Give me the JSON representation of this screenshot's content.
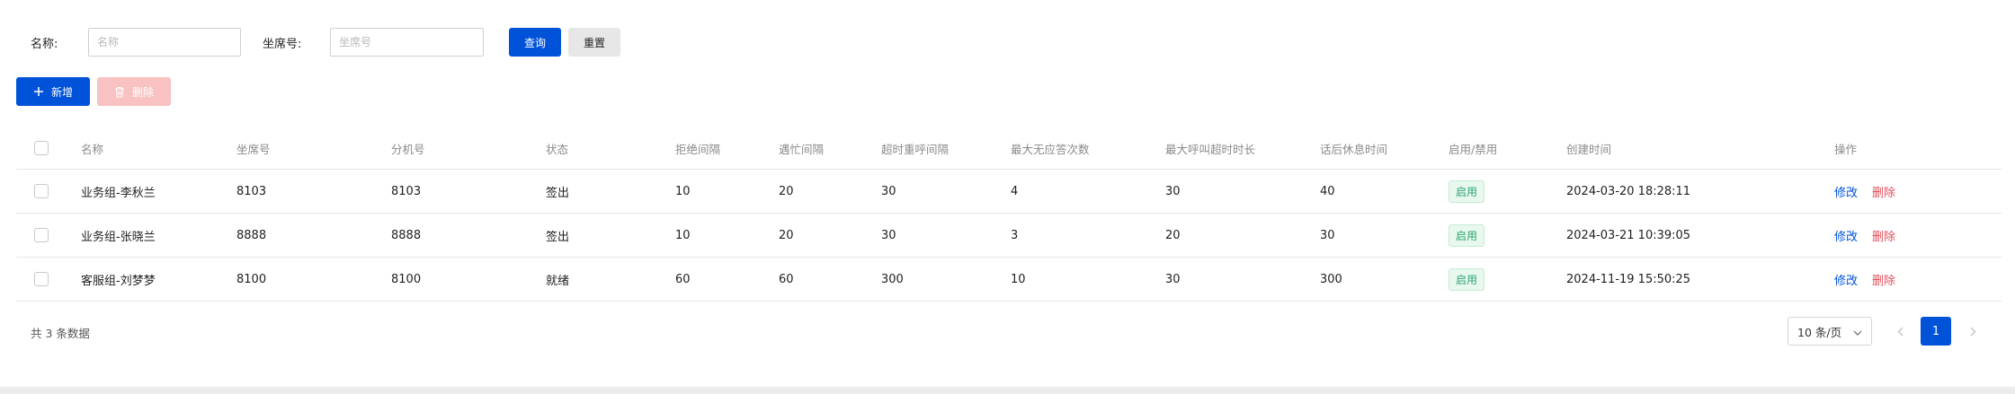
{
  "search": {
    "name_label": "名称:",
    "name_placeholder": "名称",
    "seat_label": "坐席号:",
    "seat_placeholder": "坐席号",
    "query_button": "查询",
    "reset_button": "重置"
  },
  "toolbar": {
    "add_button": "新增",
    "delete_button": "删除"
  },
  "table": {
    "columns": [
      "名称",
      "坐席号",
      "分机号",
      "状态",
      "拒绝间隔",
      "遇忙间隔",
      "超时重呼间隔",
      "最大无应答次数",
      "最大呼叫超时时长",
      "话后休息时间",
      "启用/禁用",
      "创建时间",
      "操作"
    ],
    "rows": [
      {
        "name": "业务组-李秋兰",
        "seat": "8103",
        "ext": "8103",
        "status": "签出",
        "reject": "10",
        "busy": "20",
        "timeout_recall": "30",
        "max_noanswer": "4",
        "max_call_timeout": "30",
        "rest": "40",
        "enabled": "启用",
        "created": "2024-03-20 18:28:11",
        "edit": "修改",
        "delete": "删除"
      },
      {
        "name": "业务组-张晓兰",
        "seat": "8888",
        "ext": "8888",
        "status": "签出",
        "reject": "10",
        "busy": "20",
        "timeout_recall": "30",
        "max_noanswer": "3",
        "max_call_timeout": "20",
        "rest": "30",
        "enabled": "启用",
        "created": "2024-03-21 10:39:05",
        "edit": "修改",
        "delete": "删除"
      },
      {
        "name": "客服组-刘梦梦",
        "seat": "8100",
        "ext": "8100",
        "status": "就绪",
        "reject": "60",
        "busy": "60",
        "timeout_recall": "300",
        "max_noanswer": "10",
        "max_call_timeout": "30",
        "rest": "300",
        "enabled": "启用",
        "created": "2024-11-19 15:50:25",
        "edit": "修改",
        "delete": "删除"
      }
    ]
  },
  "pagination": {
    "total_text": "共 3 条数据",
    "page_size": "10 条/页",
    "current_page": "1"
  },
  "colors": {
    "primary": "#0052d9",
    "danger": "#e34d59",
    "success": "#2ba471"
  }
}
